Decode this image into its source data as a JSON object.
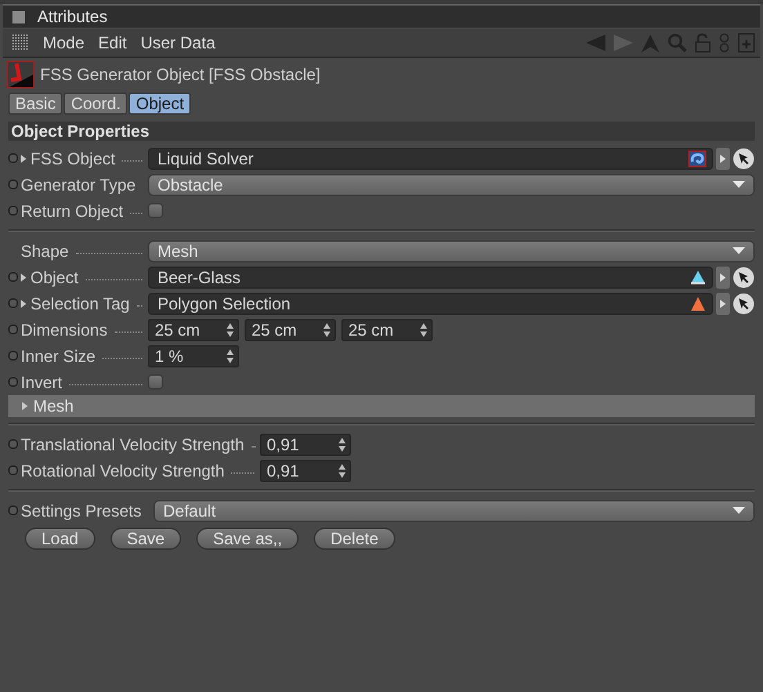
{
  "window": {
    "title": "Attributes"
  },
  "menu": [
    "Mode",
    "Edit",
    "User Data"
  ],
  "object_title": "FSS Generator Object [FSS Obstacle]",
  "tabs": [
    {
      "label": "Basic",
      "selected": false
    },
    {
      "label": "Coord.",
      "selected": false
    },
    {
      "label": "Object",
      "selected": true
    }
  ],
  "section_title": "Object Properties",
  "groups": [
    [
      {
        "kind": "link",
        "label": "FSS Object",
        "animatable": true,
        "expandable": true,
        "value": "Liquid Solver"
      },
      {
        "kind": "dropdown",
        "label": "Generator Type",
        "animatable": true,
        "value": "Obstacle"
      },
      {
        "kind": "checkbox",
        "label": "Return Object",
        "animatable": true,
        "checked": false
      }
    ],
    [
      {
        "kind": "dropdown",
        "label": "Shape",
        "animatable": false,
        "value": "Mesh"
      },
      {
        "kind": "link",
        "label": "Object",
        "animatable": true,
        "expandable": true,
        "value": "Beer-Glass"
      },
      {
        "kind": "link",
        "label": "Selection Tag",
        "animatable": true,
        "expandable": true,
        "value": "Polygon Selection"
      },
      {
        "kind": "numbers",
        "label": "Dimensions",
        "animatable": true,
        "values": [
          "25 cm",
          "25 cm",
          "25 cm"
        ]
      },
      {
        "kind": "numbers",
        "label": "Inner Size",
        "animatable": true,
        "values": [
          "1 %"
        ]
      },
      {
        "kind": "checkbox",
        "label": "Invert",
        "animatable": true,
        "checked": false
      },
      {
        "kind": "section",
        "label": "Mesh",
        "expanded": false
      }
    ],
    [
      {
        "kind": "numbers",
        "label": "Translational Velocity Strength",
        "animatable": true,
        "values": [
          "0,91"
        ]
      },
      {
        "kind": "numbers",
        "label": "Rotational Velocity Strength",
        "animatable": true,
        "values": [
          "0,91"
        ]
      }
    ],
    [
      {
        "kind": "dropdown",
        "label": "Settings Presets",
        "animatable": true,
        "value": "Default"
      }
    ]
  ],
  "buttons": [
    "Load",
    "Save",
    "Save as,,",
    "Delete"
  ]
}
